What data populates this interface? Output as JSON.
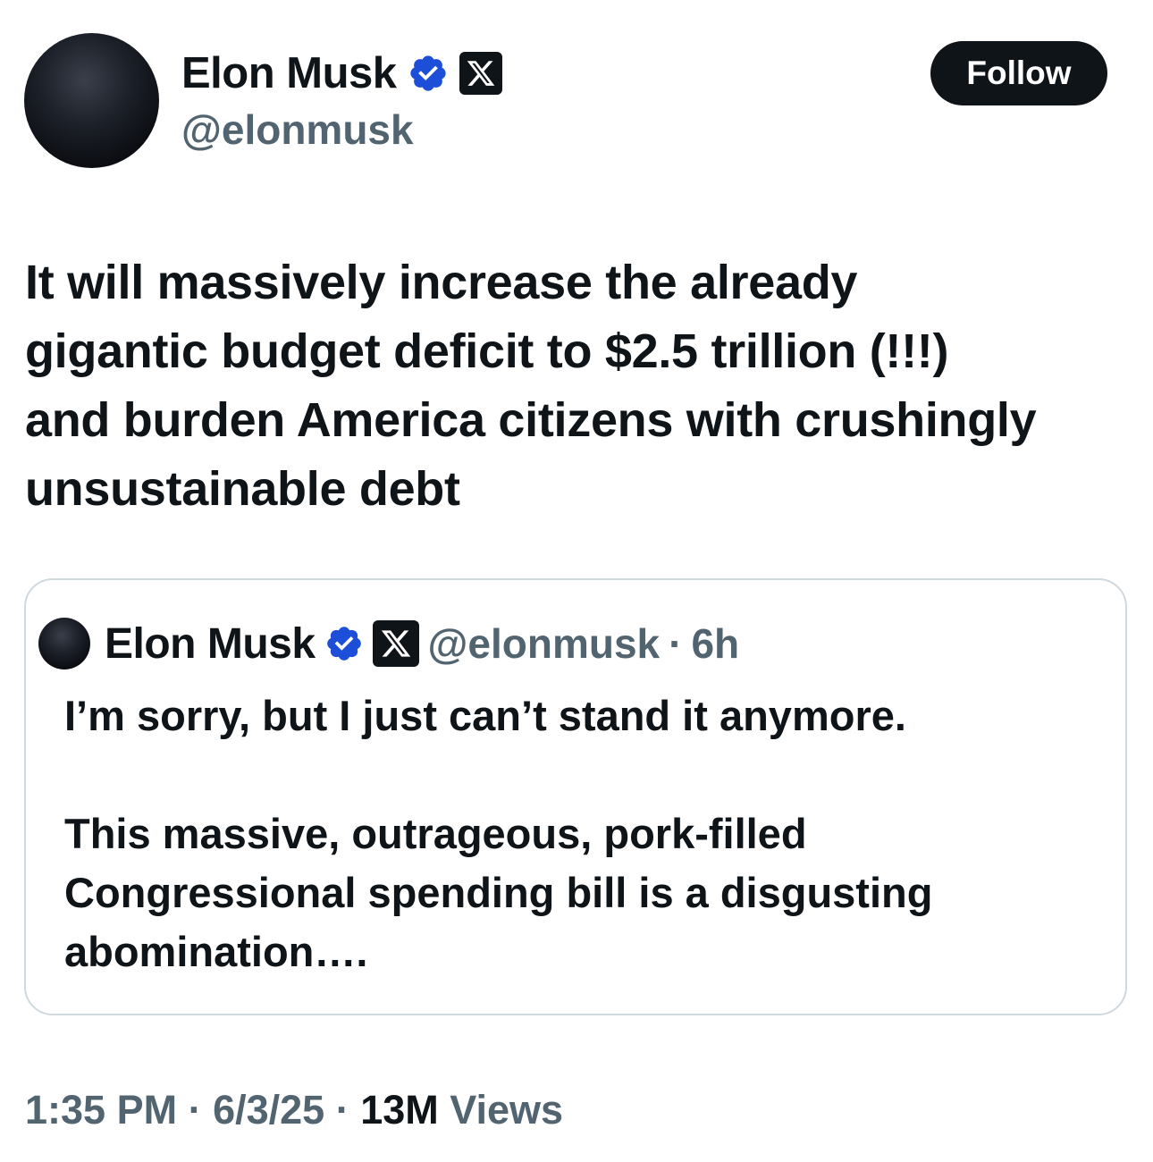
{
  "author": {
    "name": "Elon Musk",
    "handle": "@elonmusk",
    "verified_icon": "verified-badge-icon",
    "affiliate_icon": "x-logo-icon"
  },
  "actions": {
    "follow_label": "Follow"
  },
  "tweet": {
    "text": "It will massively increase the already\ngigantic budget deficit to $2.5 trillion (!!!)\nand burden America citizens with crushingly\nunsustainable debt"
  },
  "quoted_tweet": {
    "name": "Elon Musk",
    "handle": "@elonmusk",
    "separator": "·",
    "time": "6h",
    "text": "I’m sorry, but I just can’t stand it anymore.\n\nThis massive, outrageous, pork-filled\nCongressional spending bill is a disgusting\nabomination…."
  },
  "footer": {
    "time": "1:35 PM",
    "date": "6/3/25",
    "separator": " · ",
    "views_count": "13M",
    "views_label": " Views"
  },
  "colors": {
    "text_primary": "#0f1419",
    "text_secondary": "#536471",
    "verified_blue": "#1d4ed8",
    "border": "#cfd9de"
  }
}
